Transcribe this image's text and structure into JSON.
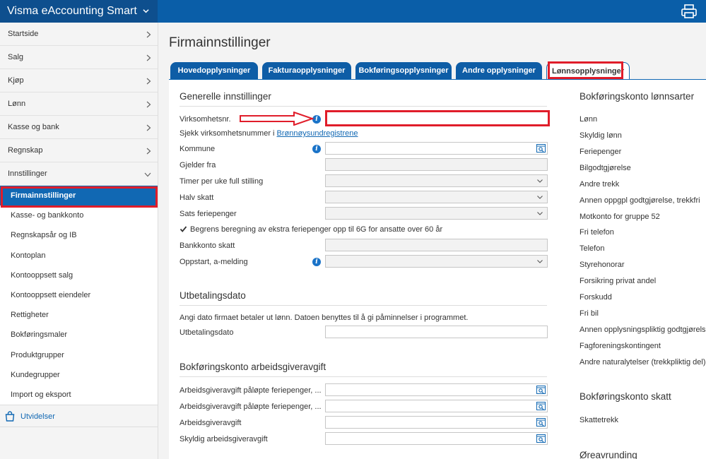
{
  "app": {
    "title": "Visma eAccounting Smart"
  },
  "sidebar": {
    "items": [
      {
        "label": "Startside"
      },
      {
        "label": "Salg"
      },
      {
        "label": "Kjøp"
      },
      {
        "label": "Lønn"
      },
      {
        "label": "Kasse og bank"
      },
      {
        "label": "Regnskap"
      },
      {
        "label": "Innstillinger"
      }
    ],
    "sub_items": [
      {
        "label": "Firmainnstillinger"
      },
      {
        "label": "Kasse- og bankkonto"
      },
      {
        "label": "Regnskapsår og IB"
      },
      {
        "label": "Kontoplan"
      },
      {
        "label": "Kontooppsett salg"
      },
      {
        "label": "Kontooppsett eiendeler"
      },
      {
        "label": "Rettigheter"
      },
      {
        "label": "Bokføringsmaler"
      },
      {
        "label": "Produktgrupper"
      },
      {
        "label": "Kundegrupper"
      },
      {
        "label": "Import og eksport"
      }
    ],
    "extensions_label": "Utvidelser"
  },
  "page": {
    "title": "Firmainnstillinger",
    "tabs": [
      {
        "label": "Hovedopplysninger"
      },
      {
        "label": "Fakturaopplysninger"
      },
      {
        "label": "Bokføringsopplysninger"
      },
      {
        "label": "Andre opplysninger"
      },
      {
        "label": "Lønnsopplysninger"
      }
    ]
  },
  "general": {
    "title": "Generelle innstillinger",
    "org_nr_label": "Virksomhetsnr.",
    "check_text": "Sjekk virksomhetsnummer i",
    "check_link": "Brønnøysundregistrene",
    "kommune_label": "Kommune",
    "gjelder_fra_label": "Gjelder fra",
    "timer_label": "Timer per uke full stilling",
    "halv_skatt_label": "Halv skatt",
    "sats_label": "Sats feriepenger",
    "begrens_label": "Begrens beregning av ekstra feriepenger opp til 6G for ansatte over 60 år",
    "bankkonto_label": "Bankkonto skatt",
    "oppstart_label": "Oppstart, a-melding"
  },
  "payout": {
    "title": "Utbetalingsdato",
    "description": "Angi dato firmaet betaler ut lønn. Datoen benyttes til å gi påminnelser i programmet.",
    "date_label": "Utbetalingsdato"
  },
  "employer_tax": {
    "title": "Bokføringskonto arbeidsgiveravgift",
    "labels": [
      "Arbeidsgiveravgift påløpte feriepenger, ...",
      "Arbeidsgiveravgift påløpte feriepenger, ...",
      "Arbeidsgiveravgift",
      "Skyldig arbeidsgiveravgift"
    ]
  },
  "right": {
    "wage_title": "Bokføringskonto lønnsarter",
    "wage_items": [
      "Lønn",
      "Skyldig lønn",
      "Feriepenger",
      "Bilgodtgjørelse",
      "Andre trekk",
      "Annen oppgpl godtgjørelse, trekkfri",
      "Motkonto for gruppe 52",
      "Fri telefon",
      "Telefon",
      "Styrehonorar",
      "Forsikring privat andel",
      "Forskudd",
      "Fri bil",
      "Annen opplysningspliktig godtgjørelse",
      "Fagforeningskontingent",
      "Andre naturalytelser (trekkpliktig del)"
    ],
    "tax_title": "Bokføringskonto skatt",
    "tax_items": [
      "Skattetrekk"
    ],
    "rounding_title": "Øreavrunding"
  },
  "colors": {
    "accent": "#1168b3",
    "header": "#0a5ea8",
    "highlight": "#e01d2a"
  }
}
